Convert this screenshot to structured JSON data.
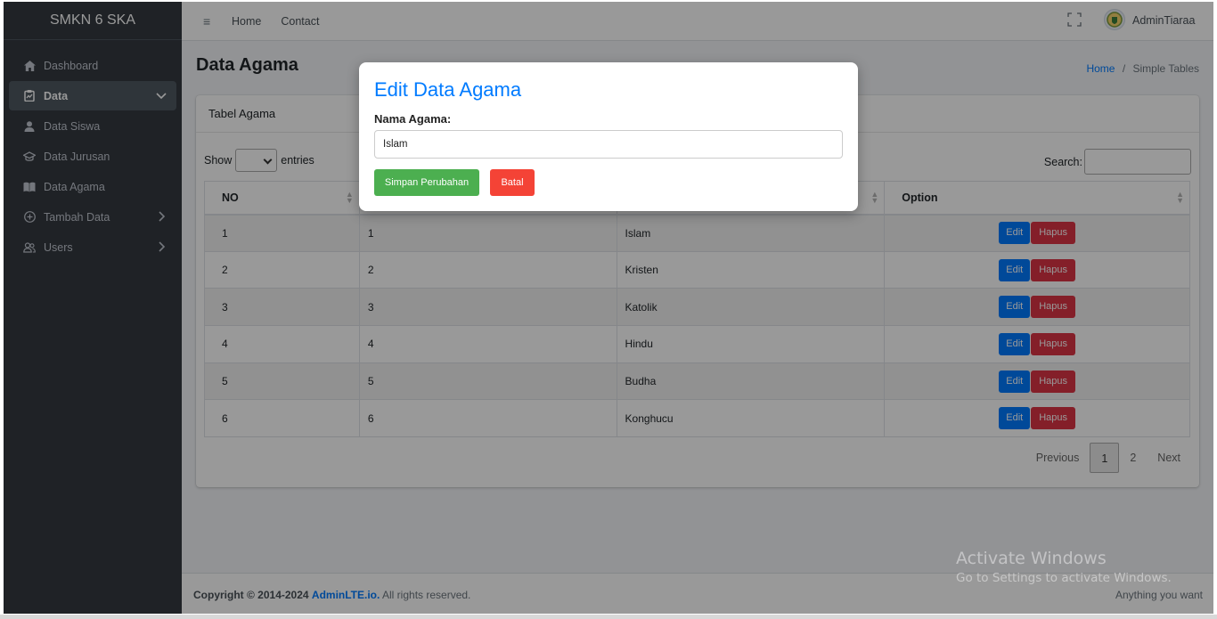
{
  "brand": "SMKN 6 SKA",
  "sidebar": {
    "items": [
      {
        "label": "Dashboard",
        "icon": "home-icon"
      },
      {
        "label": "Data",
        "icon": "clipboard-icon"
      },
      {
        "label": "Data Siswa",
        "icon": "user-icon"
      },
      {
        "label": "Data Jurusan",
        "icon": "graduation-cap-icon"
      },
      {
        "label": "Data Agama",
        "icon": "book-icon"
      },
      {
        "label": "Tambah Data",
        "icon": "plus-circle-icon"
      },
      {
        "label": "Users",
        "icon": "users-icon"
      }
    ]
  },
  "topbar": {
    "home": "Home",
    "contact": "Contact",
    "user": "AdminTiaraa"
  },
  "page": {
    "title": "Data Agama",
    "breadcrumb_home": "Home",
    "breadcrumb_sep": "/",
    "breadcrumb_current": "Simple Tables"
  },
  "card": {
    "title": "Tabel Agama"
  },
  "table": {
    "show_label": "Show",
    "entries_label": "entries",
    "search_label": "Search:",
    "columns": [
      "NO",
      "",
      "",
      "Option"
    ],
    "rows": [
      {
        "no": "1",
        "id": "1",
        "agama": "Islam"
      },
      {
        "no": "2",
        "id": "2",
        "agama": "Kristen"
      },
      {
        "no": "3",
        "id": "3",
        "agama": "Katolik"
      },
      {
        "no": "4",
        "id": "4",
        "agama": "Hindu"
      },
      {
        "no": "5",
        "id": "5",
        "agama": "Budha"
      },
      {
        "no": "6",
        "id": "6",
        "agama": "Konghucu"
      }
    ],
    "edit_label": "Edit",
    "delete_label": "Hapus"
  },
  "pagination": {
    "previous": "Previous",
    "pages": [
      "1",
      "2"
    ],
    "next": "Next"
  },
  "footer": {
    "copyright": "Copyright © 2014-2024",
    "brand": "AdminLTE.io.",
    "rights": "All rights reserved.",
    "right_text": "Anything you want"
  },
  "watermark": {
    "line1": "Activate Windows",
    "line2": "Go to Settings to activate Windows."
  },
  "modal": {
    "title": "Edit Data Agama",
    "field_label": "Nama Agama:",
    "field_value": "Islam",
    "save_label": "Simpan Perubahan",
    "cancel_label": "Batal"
  },
  "colors": {
    "accent": "#007bff",
    "sidebar": "#343a40",
    "save": "#4caf50",
    "cancel": "#f44336",
    "danger": "#dc3545"
  }
}
